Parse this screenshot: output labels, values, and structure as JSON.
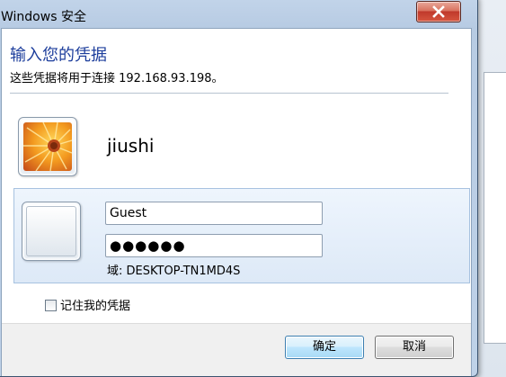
{
  "window": {
    "title": "Windows 安全"
  },
  "dialog": {
    "heading": "输入您的凭据",
    "subtext": "这些凭据将用于连接 192.168.93.198。"
  },
  "saved_user": {
    "name": "jiushi",
    "avatar_icon": "flower-avatar-icon"
  },
  "credentials": {
    "username_value": "Guest",
    "password_value": "●●●●●●",
    "domain_text": "域: DESKTOP-TN1MD4S",
    "avatar_icon": "blank-user-icon"
  },
  "remember": {
    "label": "记住我的凭据",
    "checked": false
  },
  "buttons": {
    "ok_label": "确定",
    "cancel_label": "取消"
  },
  "colors": {
    "heading": "#1d3e9c",
    "close_button": "#c0392b",
    "selection_box": "#dde9f7"
  }
}
